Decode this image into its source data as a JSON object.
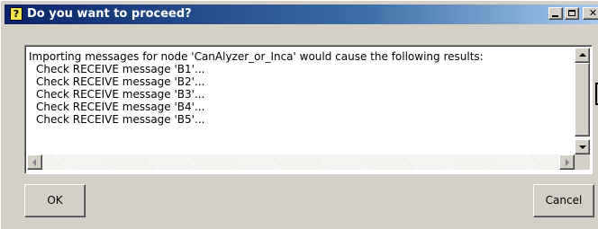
{
  "window": {
    "title": "Do you want to proceed?",
    "icon": "question-icon",
    "title_icon_glyph": "?",
    "close_glyph": "✕"
  },
  "message": {
    "lines": [
      "Importing messages for node 'CanAlyzer_or_Inca' would cause the following results:",
      "Check RECEIVE message 'B1'...",
      "Check RECEIVE message 'B2'...",
      "Check RECEIVE message 'B3'...",
      "Check RECEIVE message 'B4'...",
      "Check RECEIVE message 'B5'..."
    ]
  },
  "buttons": {
    "ok_label": "OK",
    "cancel_label": "Cancel"
  },
  "colors": {
    "titlebar_start": "#0a246a",
    "titlebar_end": "#a6caf0",
    "dialog_face": "#d4d0c8"
  }
}
